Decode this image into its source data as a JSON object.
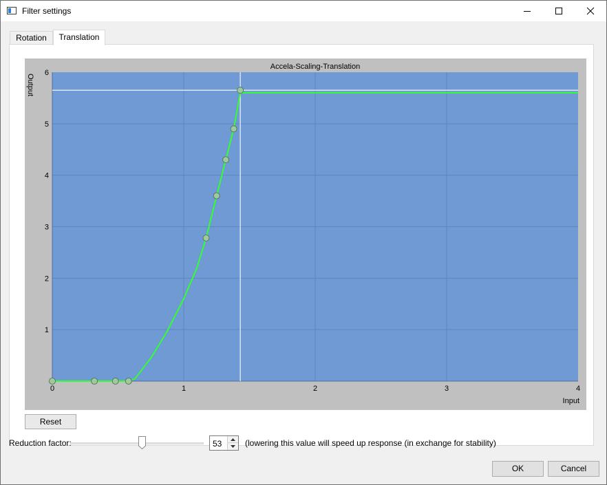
{
  "window": {
    "title": "Filter settings",
    "controls": [
      "minimize-icon",
      "maximize-icon",
      "close-icon"
    ]
  },
  "tabs": [
    {
      "label": "Rotation",
      "active": false
    },
    {
      "label": "Translation",
      "active": true
    }
  ],
  "chart_data": {
    "type": "line",
    "title": "Accela-Scaling-Translation",
    "xlabel": "Input",
    "ylabel": "Output",
    "xlim": [
      0,
      4
    ],
    "ylim": [
      0,
      6
    ],
    "x_ticks": [
      "0",
      "1",
      "2",
      "3",
      "4"
    ],
    "y_ticks": [
      "1",
      "2",
      "3",
      "4",
      "5",
      "6"
    ],
    "grid": true,
    "series": [
      {
        "color": "#33ff33",
        "points": [
          [
            0,
            0
          ],
          [
            0.32,
            0
          ],
          [
            0.48,
            0
          ],
          [
            0.58,
            0
          ],
          [
            0.63,
            0.05
          ],
          [
            0.75,
            0.45
          ],
          [
            0.87,
            0.95
          ],
          [
            1.0,
            1.6
          ],
          [
            1.1,
            2.2
          ],
          [
            1.17,
            2.78
          ],
          [
            1.25,
            3.6
          ],
          [
            1.32,
            4.3
          ],
          [
            1.38,
            4.9
          ],
          [
            1.43,
            5.6
          ],
          [
            4,
            5.6
          ]
        ],
        "control_points": [
          [
            0,
            0
          ],
          [
            0.32,
            0
          ],
          [
            0.48,
            0
          ],
          [
            0.58,
            0
          ],
          [
            1.17,
            2.78
          ],
          [
            1.25,
            3.6
          ],
          [
            1.32,
            4.3
          ],
          [
            1.38,
            4.9
          ],
          [
            1.43,
            5.65
          ]
        ]
      }
    ],
    "cursor": {
      "x": 1.43,
      "y": 5.65
    },
    "colors": {
      "plot_bg": "#6f9ad3",
      "frame_bg": "#c0c0c0",
      "grid": "#5d86be",
      "cursor": "#e9eef6",
      "point_fill": "#9ec99e"
    }
  },
  "buttons": {
    "reset": "Reset",
    "ok": "OK",
    "cancel": "Cancel"
  },
  "reduction": {
    "label": "Reduction factor:",
    "value": "53",
    "slider_fraction": 0.53,
    "hint": "(lowering this value will speed up response (in exchange for stability)"
  }
}
